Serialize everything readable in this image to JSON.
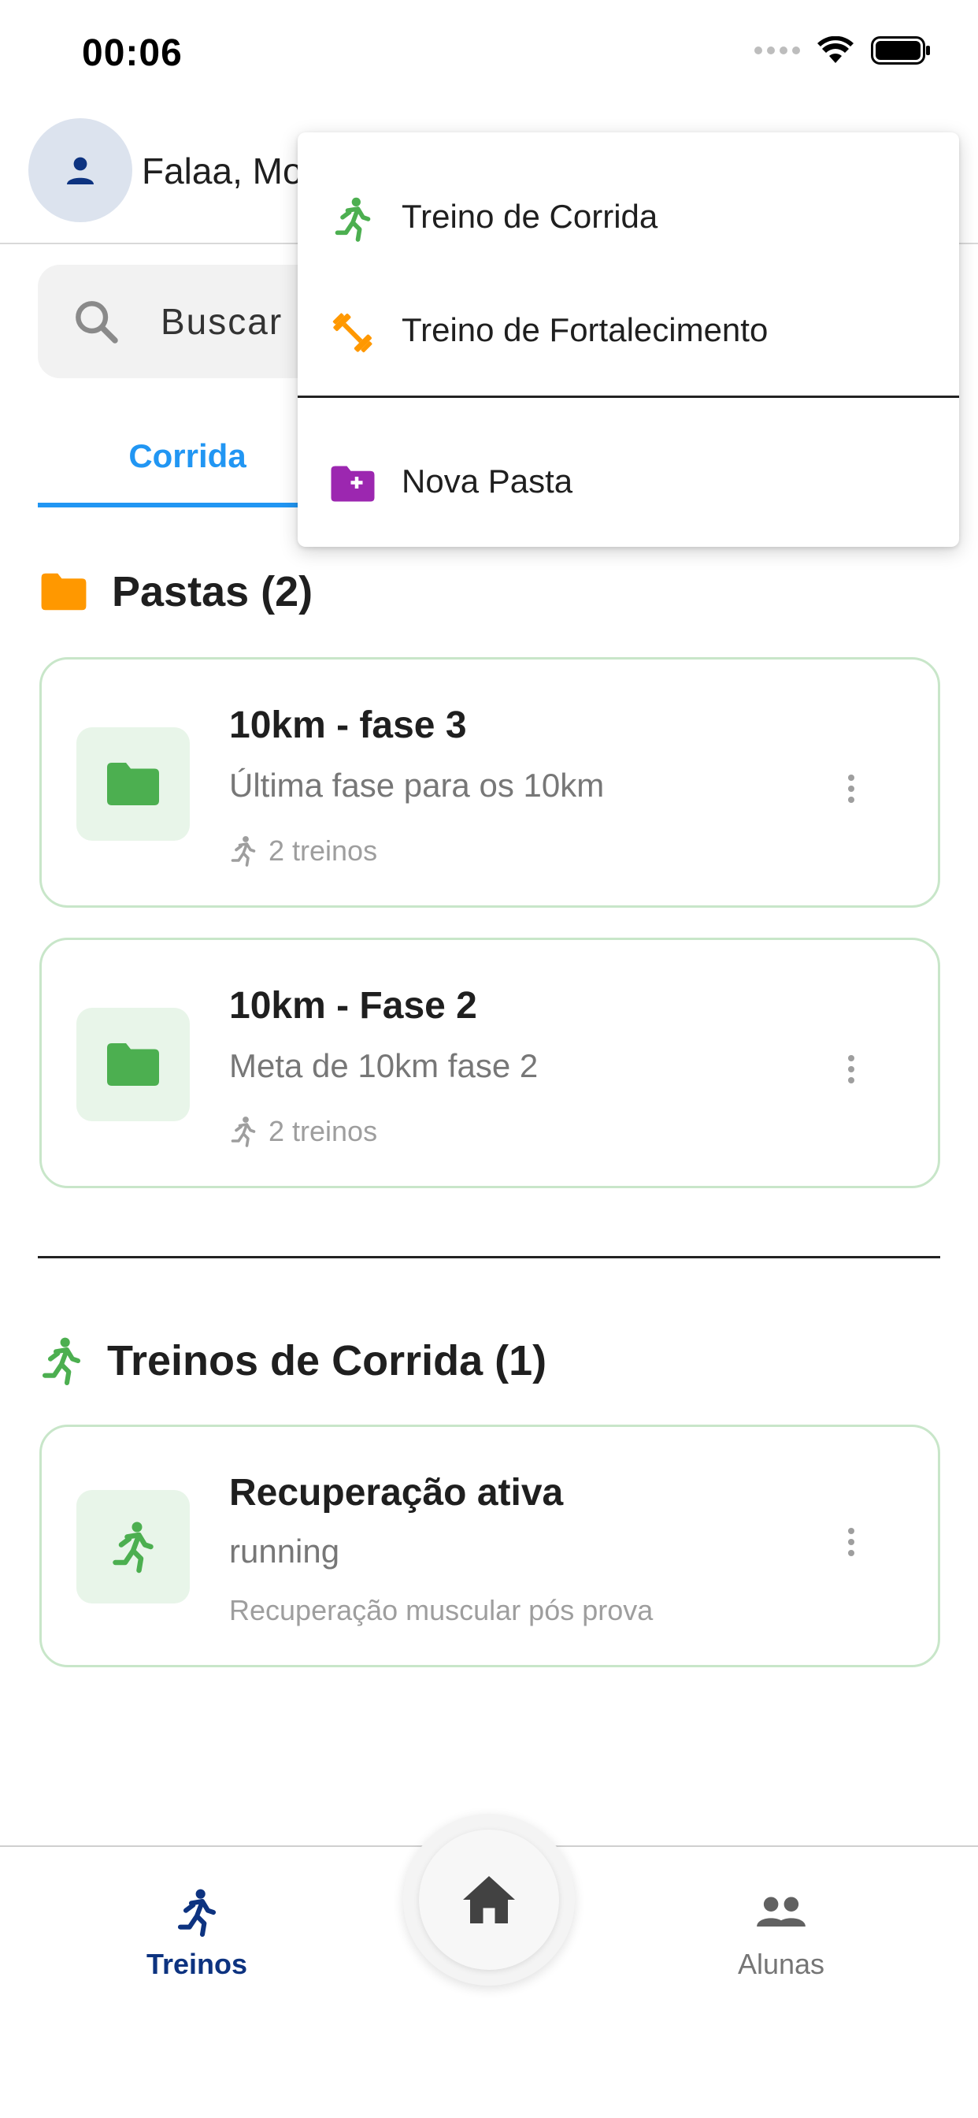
{
  "status_bar": {
    "time": "00:06",
    "icons": [
      "signal-icon",
      "wifi-icon",
      "battery-icon"
    ]
  },
  "header": {
    "greeting": "Falaa, Mo",
    "avatar_icon": "person-icon"
  },
  "search": {
    "placeholder": "Buscar"
  },
  "tabs": [
    {
      "label": "Corrida",
      "active": true
    }
  ],
  "folders_section": {
    "title": "Pastas (2)",
    "icon": "folder-icon",
    "items": [
      {
        "title": "10km - fase 3",
        "subtitle": "Última fase para os 10km",
        "meta": "2 treinos"
      },
      {
        "title": "10km - Fase 2",
        "subtitle": "Meta de 10km fase 2",
        "meta": "2 treinos"
      }
    ]
  },
  "runs_section": {
    "title": "Treinos de Corrida (1)",
    "icon": "running-icon",
    "items": [
      {
        "title": "Recuperação ativa",
        "subtitle": "running",
        "meta": "Recuperação muscular pós prova"
      }
    ]
  },
  "menu": {
    "items": [
      {
        "label": "Treino de Corrida",
        "icon": "running-icon"
      },
      {
        "label": "Treino de Fortalecimento",
        "icon": "dumbbell-icon"
      },
      {
        "label": "Nova Pasta",
        "icon": "folder-add-icon"
      }
    ]
  },
  "bottom_nav": {
    "treinos_label": "Treinos",
    "alunas_label": "Alunas",
    "home_icon": "home-icon"
  },
  "colors": {
    "accent_blue": "#2196f3",
    "nav_active": "#0d3380",
    "green": "#4caf50",
    "orange": "#ff9800",
    "purple": "#9c27b0"
  }
}
